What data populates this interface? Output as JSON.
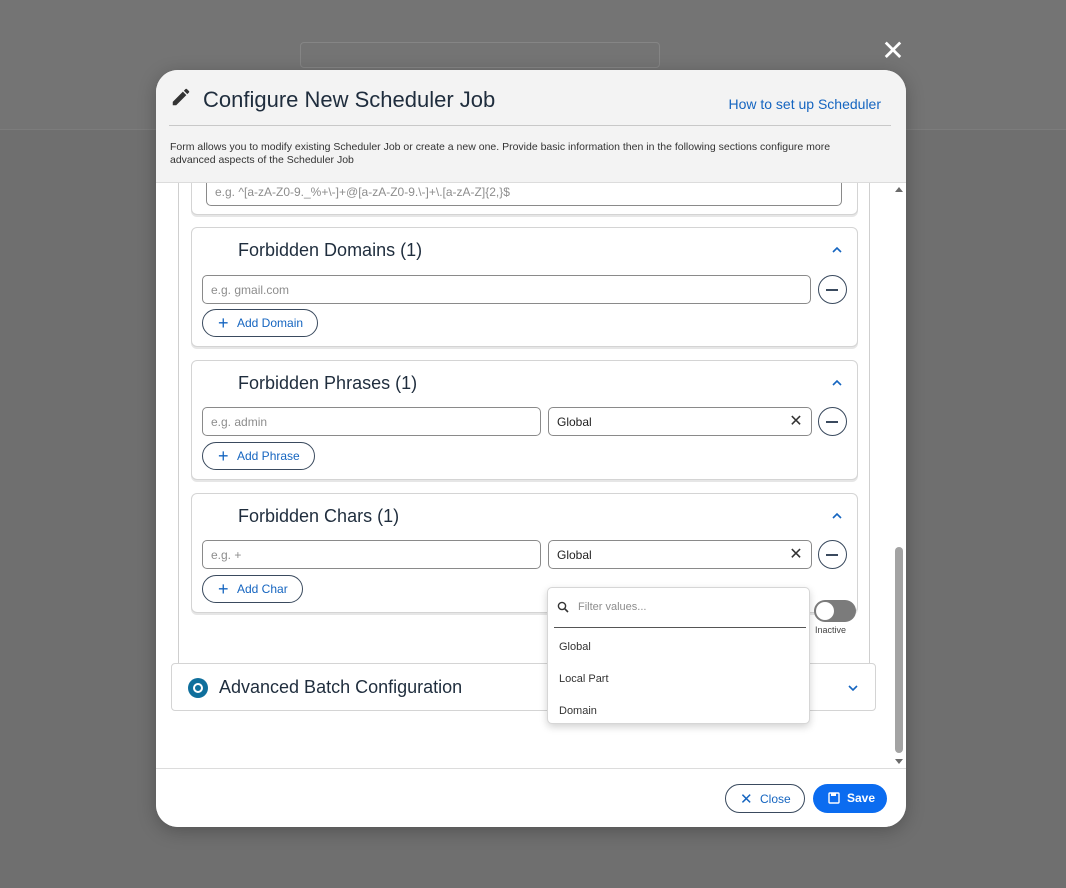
{
  "modal": {
    "title": "Configure New Scheduler Job",
    "help_link": "How to set up Scheduler",
    "description": "Form allows you to modify existing Scheduler Job or create a new one. Provide basic information then in the following sections configure more advanced aspects of the Scheduler Job",
    "close_symbol": "✕"
  },
  "regex_field": {
    "placeholder": "e.g. ^[a-zA-Z0-9._%+\\-]+@[a-zA-Z0-9.\\-]+\\.[a-zA-Z]{2,}$",
    "value": ""
  },
  "sections": {
    "domains": {
      "title": "Forbidden Domains (1)",
      "input_placeholder": "e.g. gmail.com",
      "add_label": "Add Domain"
    },
    "phrases": {
      "title": "Forbidden Phrases (1)",
      "input_placeholder": "e.g. admin",
      "select_value": "Global",
      "add_label": "Add Phrase"
    },
    "chars": {
      "title": "Forbidden Chars (1)",
      "input_placeholder": "e.g. +",
      "select_value": "Global",
      "add_label": "Add Char"
    }
  },
  "toggle": {
    "label": "Inactive",
    "on": false
  },
  "advanced": {
    "title": "Advanced Batch Configuration"
  },
  "dropdown": {
    "placeholder": "Filter values...",
    "options": [
      "Global",
      "Local Part",
      "Domain"
    ]
  },
  "footer": {
    "close_label": "Close",
    "save_label": "Save"
  },
  "icons": {
    "modal_close": "close-icon",
    "title": "pencil-icon",
    "collapse": "chevron-up-icon",
    "expand": "chevron-down-icon",
    "add": "plus-icon",
    "remove": "minus-circle-icon",
    "clear": "close-icon",
    "search": "search-icon",
    "save": "save-icon"
  },
  "colors": {
    "primary": "#0b6cf0",
    "link": "#1565c0",
    "toggle_off": "#7b7b7b",
    "advanced_icon": "#0f6f9c"
  }
}
